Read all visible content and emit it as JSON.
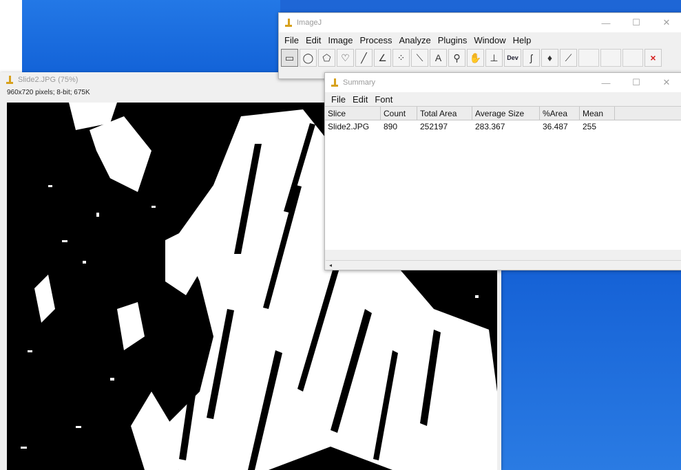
{
  "imagej": {
    "title": "ImageJ",
    "menu": [
      "File",
      "Edit",
      "Image",
      "Process",
      "Analyze",
      "Plugins",
      "Window",
      "Help"
    ],
    "tools": [
      {
        "name": "rectangle-tool-icon",
        "glyph": "▭"
      },
      {
        "name": "oval-tool-icon",
        "glyph": "◯"
      },
      {
        "name": "polygon-tool-icon",
        "glyph": "⬠"
      },
      {
        "name": "freehand-tool-icon",
        "glyph": "♡"
      },
      {
        "name": "line-tool-icon",
        "glyph": "╱"
      },
      {
        "name": "angle-tool-icon",
        "glyph": "∠"
      },
      {
        "name": "point-tool-icon",
        "glyph": "⁘"
      },
      {
        "name": "wand-tool-icon",
        "glyph": "⟍"
      },
      {
        "name": "text-tool-icon",
        "glyph": "A"
      },
      {
        "name": "magnifier-tool-icon",
        "glyph": "⚲"
      },
      {
        "name": "hand-tool-icon",
        "glyph": "✋"
      },
      {
        "name": "dropper-tool-icon",
        "glyph": "⊥"
      },
      {
        "name": "dev-tool-icon",
        "glyph": "Dev"
      },
      {
        "name": "brush-tool-icon",
        "glyph": "ʃ"
      },
      {
        "name": "flood-fill-tool-icon",
        "glyph": "♦"
      },
      {
        "name": "pencil-tool-icon",
        "glyph": "⟋"
      }
    ],
    "close_glyph": "×",
    "accent_red": "#d62020"
  },
  "image_window": {
    "title": "Slide2.JPG (75%)",
    "info": "960x720 pixels; 8-bit; 675K"
  },
  "summary": {
    "title": "Summary",
    "menu": [
      "File",
      "Edit",
      "Font"
    ],
    "columns": [
      "Slice",
      "Count",
      "Total Area",
      "Average Size",
      "%Area",
      "Mean"
    ],
    "rows": [
      [
        "Slide2.JPG",
        "890",
        "252197",
        "283.367",
        "36.487",
        "255"
      ]
    ],
    "scroll_left_glyph": "◂"
  },
  "window_controls": {
    "minimize": "—",
    "maximize": "☐",
    "close": "✕"
  }
}
